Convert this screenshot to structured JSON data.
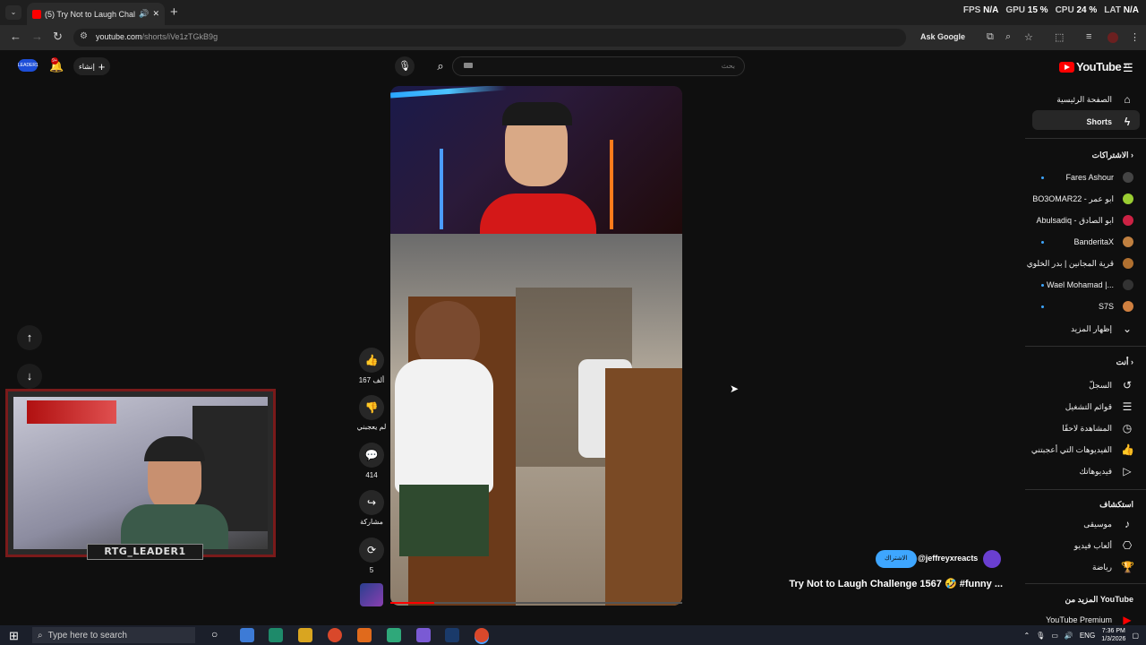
{
  "browser": {
    "tab_title": "(5) Try Not to Laugh Challe",
    "new_tab": "+",
    "url_host": "youtube.com",
    "url_path": "/shorts/iVe1zTGkB9g",
    "ask_google": "Ask Google",
    "stats": {
      "fps_label": "FPS",
      "fps_value": "N/A",
      "gpu_label": "GPU",
      "gpu_value": "15 %",
      "cpu_label": "CPU",
      "cpu_value": "24 %",
      "lat_label": "LAT",
      "lat_value": "N/A"
    }
  },
  "youtube": {
    "logo_text": "YouTube",
    "logo_region": "JO",
    "search_placeholder": "بحث",
    "create_label": "إنشاء",
    "notif_count": "9+",
    "avatar_label": "LEADER1"
  },
  "sidebar": {
    "main": [
      {
        "label": "الصفحة الرئيسية",
        "icon": "home-icon"
      },
      {
        "label": "Shorts",
        "icon": "shorts-icon"
      }
    ],
    "subs_header": "الاشتراكات",
    "subs": [
      {
        "label": "Fares Ashour",
        "color": "#444444"
      },
      {
        "label": "BO3OMAR22 - ابو عمر",
        "color": "#9acd32"
      },
      {
        "label": "Abulsadiq - ابو الصادق",
        "color": "#cc2244"
      },
      {
        "label": "BanderitaX",
        "color": "#c08040"
      },
      {
        "label": "قرية المجانين | بدر الخلوي",
        "color": "#b07030"
      },
      {
        "label": "Wael Mohamad |...",
        "color": "#333333"
      },
      {
        "label": "S7S",
        "color": "#d08040"
      }
    ],
    "show_more": "إظهار المزيد",
    "you_header": "أنت",
    "you": [
      {
        "label": "السجلّ",
        "icon": "history-icon"
      },
      {
        "label": "قوائم التشغيل",
        "icon": "playlist-icon"
      },
      {
        "label": "المشاهدة لاحقًا",
        "icon": "clock-icon"
      },
      {
        "label": "الفيديوهات التي أعجبتني",
        "icon": "like-icon"
      },
      {
        "label": "فيديوهاتك",
        "icon": "your-videos-icon"
      }
    ],
    "explore_header": "استكشاف",
    "explore": [
      {
        "label": "موسيقى",
        "icon": "music-icon"
      },
      {
        "label": "ألعاب فيديو",
        "icon": "gaming-icon"
      },
      {
        "label": "رياضة",
        "icon": "trophy-icon"
      }
    ],
    "more_header": "المزيد من YouTube",
    "premium": "YouTube Premium"
  },
  "short": {
    "likes": "167 ألف",
    "dislike_label": "لم يعجبني",
    "comments": "414",
    "share_label": "مشاركة",
    "remix": "5",
    "progress": 0.15,
    "subscribe": "الاشتراك",
    "channel": "@jeffreyxreacts",
    "title": "Try Not to Laugh Challenge 1567 🤣 #funny ..."
  },
  "webcam": {
    "name": "RTG_LEADER1"
  },
  "taskbar": {
    "search_placeholder": "Type here to search",
    "lang": "ENG",
    "time": "7:36 PM",
    "date": "1/3/2026"
  }
}
